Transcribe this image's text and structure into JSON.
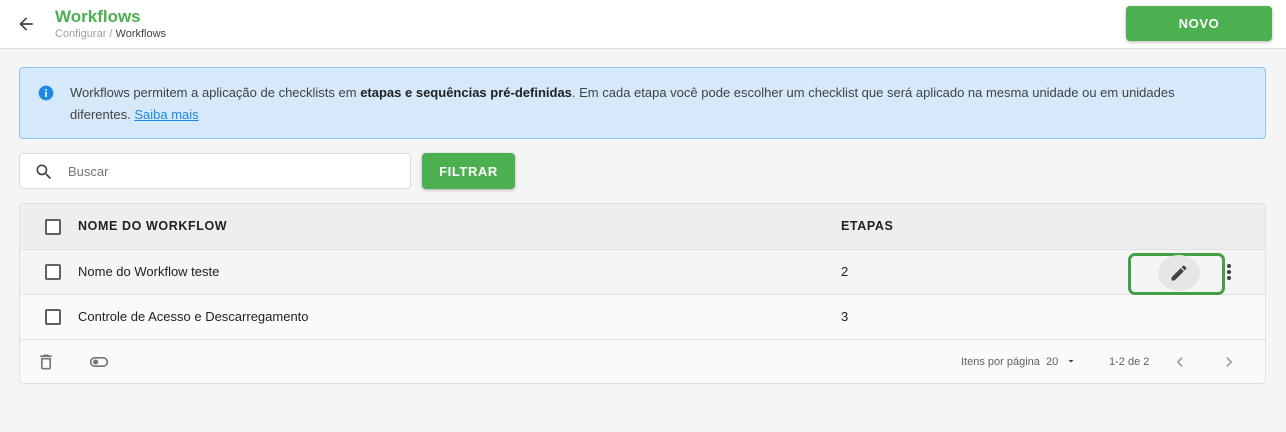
{
  "header": {
    "title": "Workflows",
    "breadcrumb": {
      "parent": "Configurar",
      "separator": " / ",
      "current": "Workflows"
    },
    "new_button": "NOVO"
  },
  "info": {
    "text_before": "Workflows permitem a aplicação de checklists em ",
    "text_bold": "etapas e sequências pré-definidas",
    "text_after": ". Em cada etapa você pode escolher um checklist que será aplicado na mesma unidade ou em unidades diferentes. ",
    "link": "Saiba mais"
  },
  "search": {
    "placeholder": "Buscar",
    "value": ""
  },
  "filter_button": "FILTRAR",
  "table": {
    "columns": {
      "name": "NOME DO WORKFLOW",
      "steps": "ETAPAS"
    },
    "rows": [
      {
        "name": "Nome do Workflow teste",
        "steps": "2"
      },
      {
        "name": "Controle de Acesso e Descarregamento",
        "steps": "3"
      }
    ]
  },
  "pagination": {
    "per_page_label": "Itens por página",
    "per_page_value": "20",
    "range": "1-2 de 2"
  },
  "colors": {
    "brand_green": "#4caf50",
    "info_bg": "#d6e9fb",
    "info_icon": "#1e88e5",
    "link": "#1e88e5"
  },
  "icons": [
    "arrow-left-icon",
    "info-icon",
    "search-icon",
    "pencil-icon",
    "more-vert-icon",
    "trash-icon",
    "toggle-icon",
    "caret-down-icon",
    "chevron-left-icon",
    "chevron-right-icon"
  ]
}
